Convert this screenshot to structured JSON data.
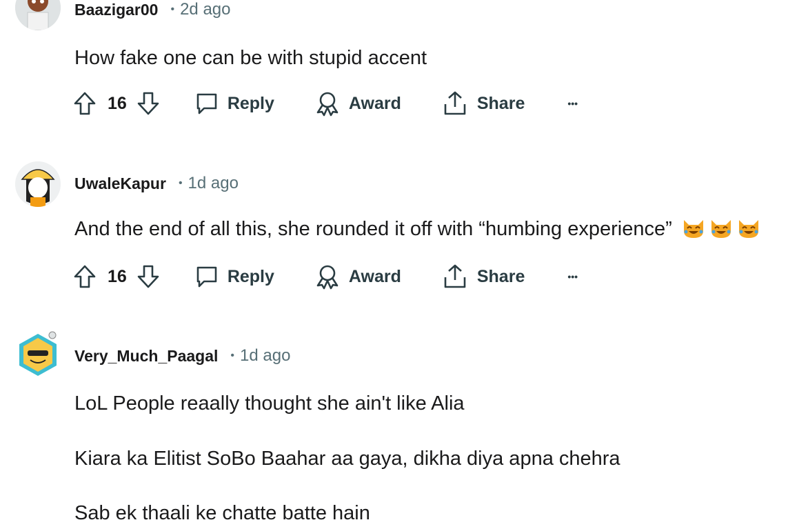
{
  "comments": [
    {
      "username": "Baazigar00",
      "separator": "•",
      "time": "2d ago",
      "text": [
        "How fake one can be with stupid accent"
      ],
      "votes": "16",
      "emoji_count": 0
    },
    {
      "username": "UwaleKapur",
      "separator": "•",
      "time": "1d ago",
      "text": [
        "And the end of all this, she rounded it off with “humbing experience”"
      ],
      "votes": "16",
      "emoji_count": 3
    },
    {
      "username": "Very_Much_Paagal",
      "separator": "•",
      "time": "1d ago",
      "text": [
        "LoL People reaally thought she ain't like Alia",
        "Kiara ka Elitist SoBo Baahar aa gaya, dikha diya apna chehra",
        "Sab ek thaali ke chatte batte hain"
      ]
    }
  ],
  "actions": {
    "reply": "Reply",
    "award": "Award",
    "share": "Share",
    "more": "•••"
  },
  "icons": {
    "upvote": "upvote-arrow-icon",
    "downvote": "downvote-arrow-icon",
    "reply": "speech-bubble-icon",
    "award": "award-ribbon-icon",
    "share": "share-upload-icon",
    "more": "more-dots-icon",
    "emoji": "joy-cat-emoji"
  },
  "colors": {
    "text": "#1a1a1b",
    "meta": "#576f76",
    "action": "#2a3c42",
    "emoji": "#f5a623"
  }
}
